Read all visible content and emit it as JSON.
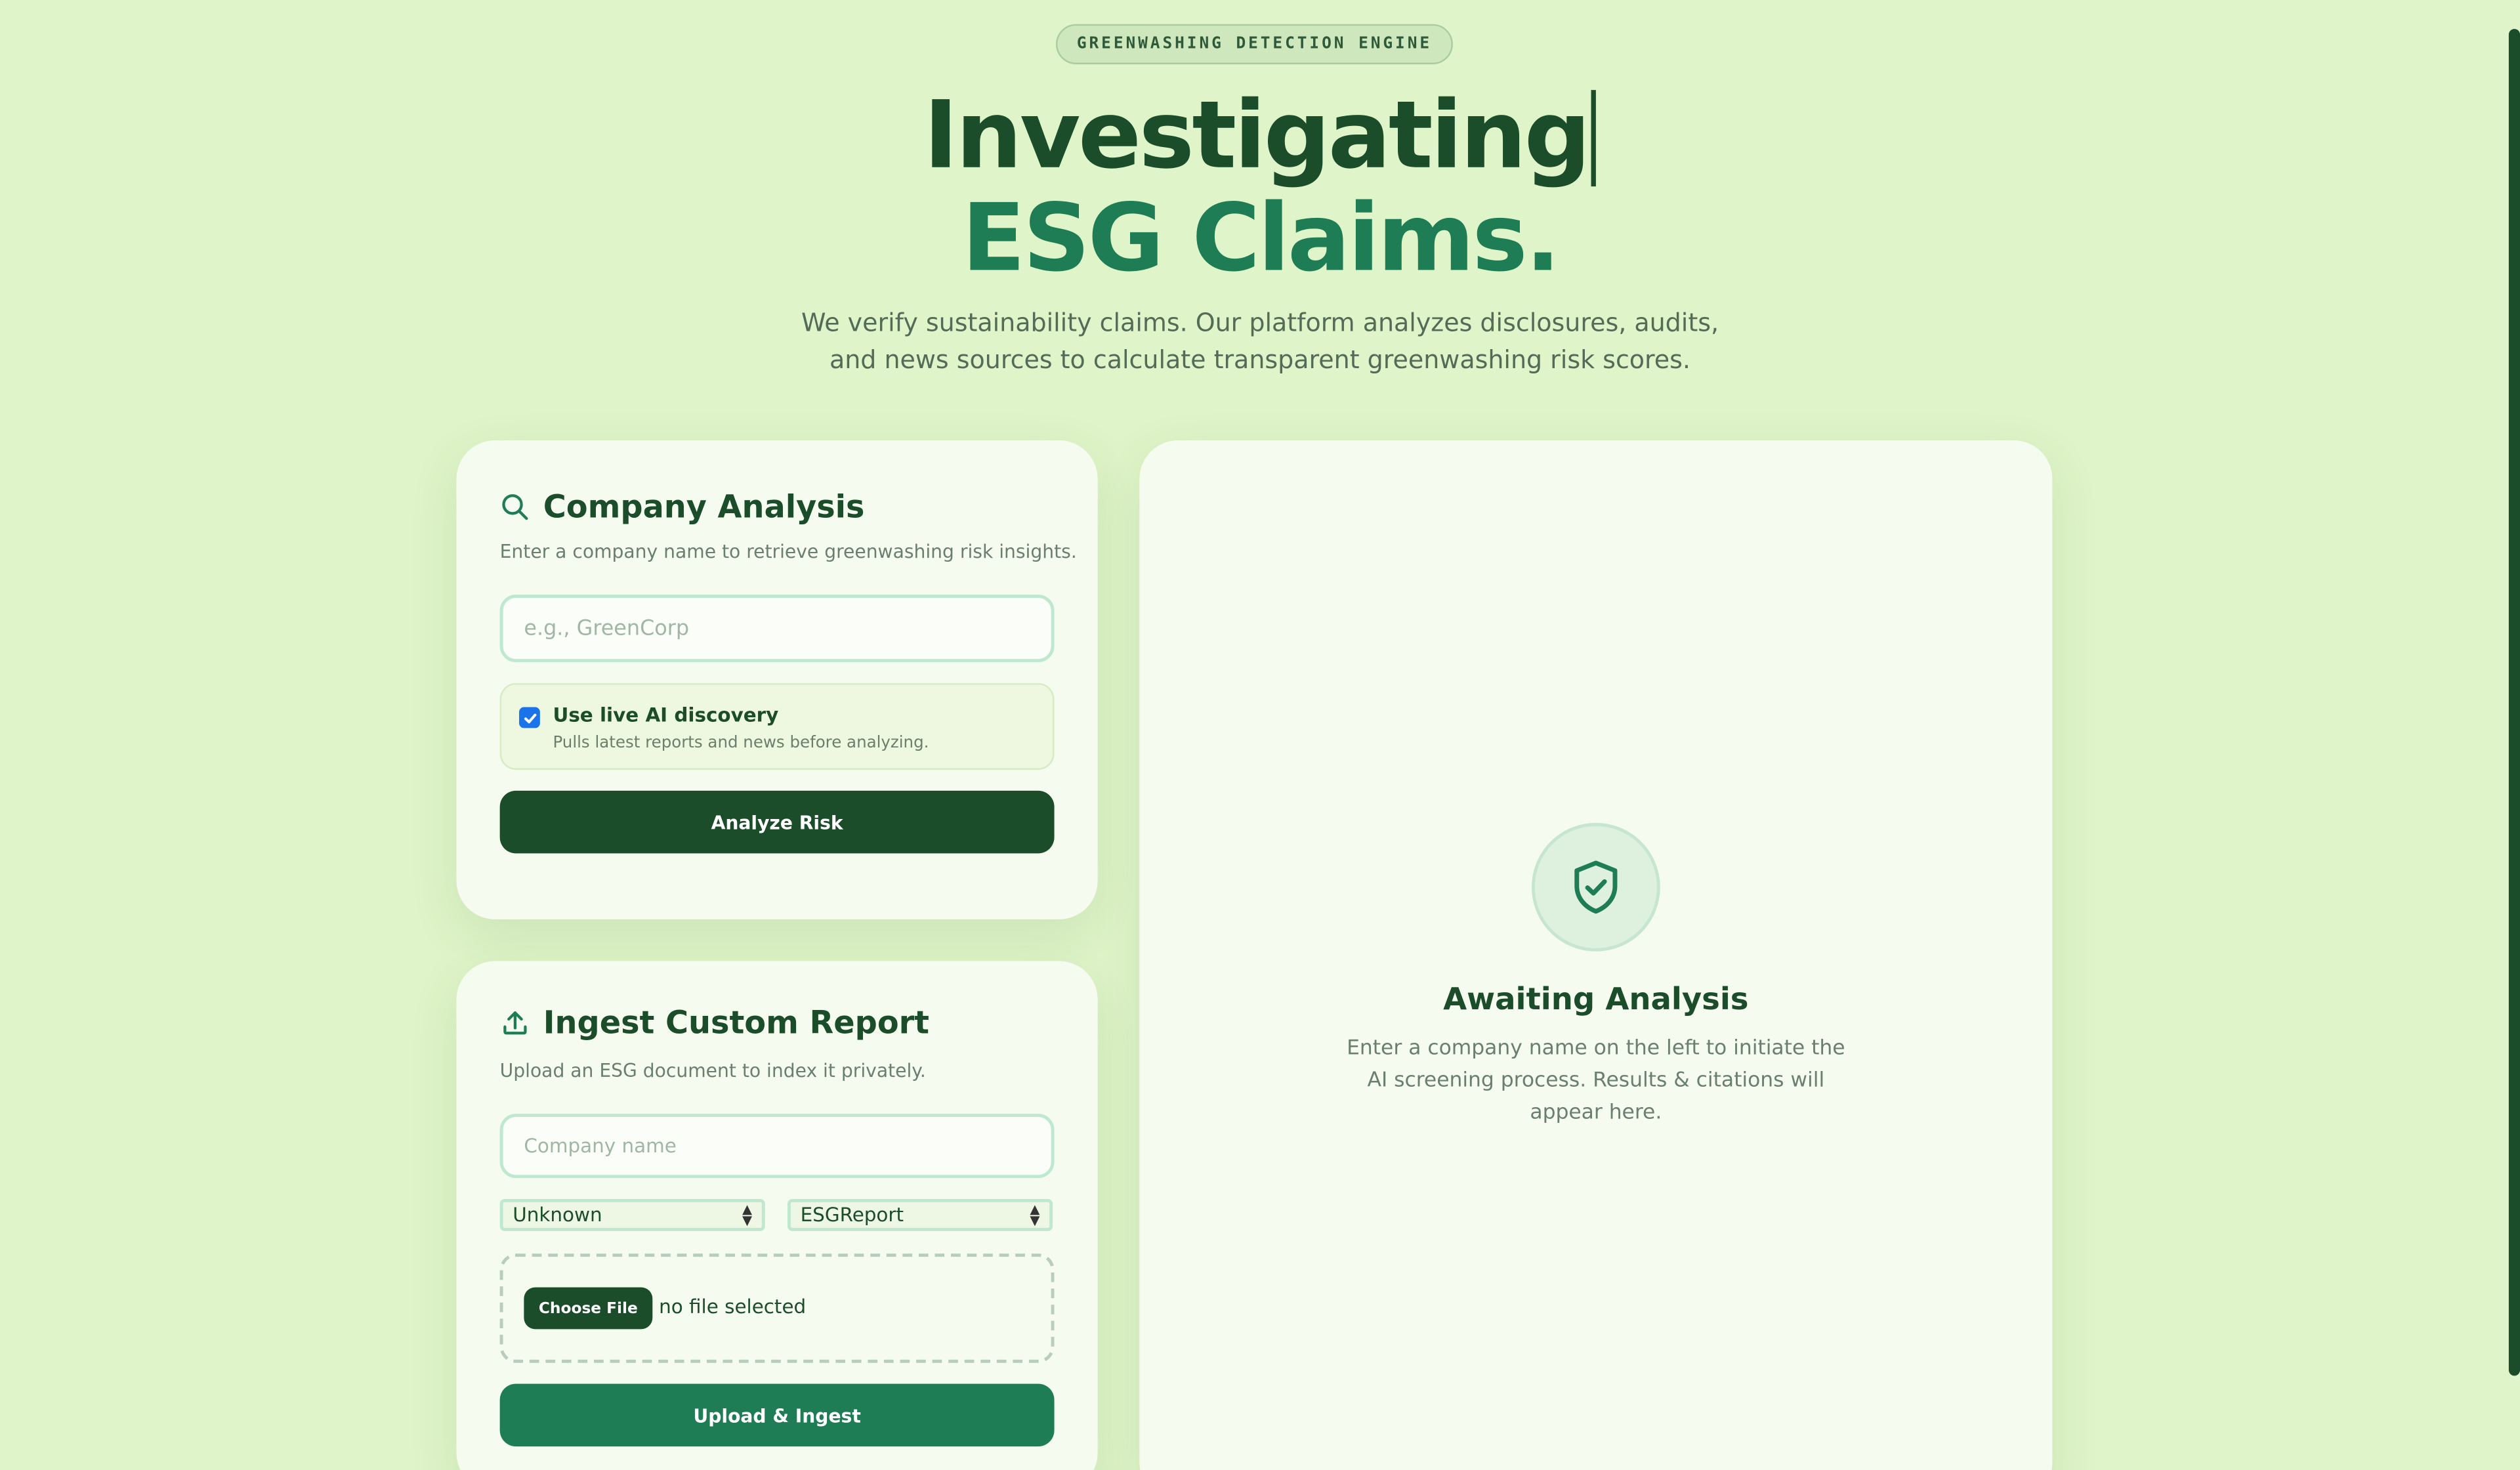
{
  "header": {
    "badge": "GREENWASHING DETECTION ENGINE",
    "title_line1": "Investigating",
    "title_line2": "ESG Claims.",
    "subtitle": "We verify sustainability claims. Our platform analyzes disclosures, audits, and news sources to calculate transparent greenwashing risk scores."
  },
  "company_analysis": {
    "icon": "search-icon",
    "title": "Company Analysis",
    "description": "Enter a company name to retrieve greenwashing risk insights.",
    "input_value": "",
    "input_placeholder": "e.g., GreenCorp",
    "ai_discovery": {
      "checked": true,
      "label": "Use live AI discovery",
      "hint": "Pulls latest reports and news before analyzing."
    },
    "button_label": "Analyze Risk"
  },
  "ingest_report": {
    "icon": "upload-icon",
    "title": "Ingest Custom Report",
    "description": "Upload an ESG document to index it privately.",
    "company_input_value": "",
    "company_input_placeholder": "Company name",
    "select1_value": "Unknown",
    "select2_value": "ESGReport",
    "file_button_label": "Choose File",
    "file_status": "no file selected",
    "button_label": "Upload & Ingest"
  },
  "results_panel": {
    "icon": "shield-check-icon",
    "title": "Awaiting Analysis",
    "description": "Enter a company name on the left to initiate the AI screening process. Results & citations will appear here."
  },
  "colors": {
    "background": "#dff4c8",
    "primary_dark": "#1b4d2b",
    "primary_mid": "#1e7d55",
    "card": "#f6fbef",
    "checkbox": "#1a73e8"
  }
}
